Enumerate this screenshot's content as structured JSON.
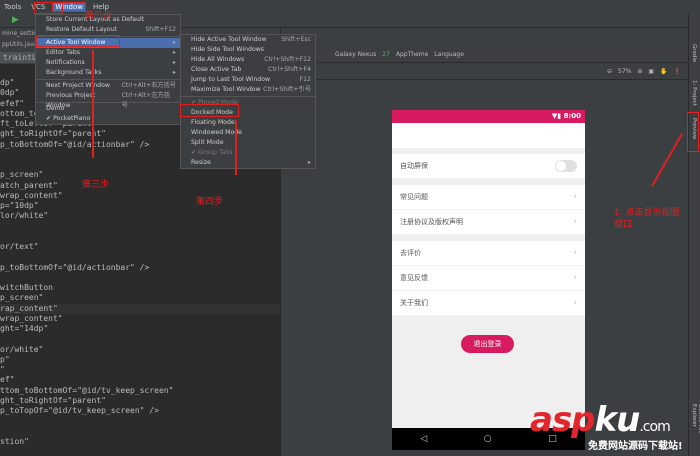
{
  "menubar": [
    "Tools",
    "VCS",
    "Window",
    "Help"
  ],
  "tabs": {
    "file1": "mine_setting",
    "file2": "ppUtils.java",
    "crumb": "traintLa"
  },
  "window_menu": [
    {
      "label": "Store Current Layout as Default",
      "shortcut": ""
    },
    {
      "label": "Restore Default Layout",
      "shortcut": "Shift+F12"
    },
    {
      "label": "Active Tool Window",
      "shortcut": "▸"
    },
    {
      "label": "Editor Tabs",
      "shortcut": "▸"
    },
    {
      "label": "Notifications",
      "shortcut": "▸"
    },
    {
      "label": "Background Tasks",
      "shortcut": "▸"
    },
    {
      "label": "Next Project Window",
      "shortcut": "Ctrl+Alt+右方括号"
    },
    {
      "label": "Previous Project Window",
      "shortcut": "Ctrl+Alt+左方括号"
    },
    {
      "label": "Demo",
      "shortcut": ""
    },
    {
      "label": "✔ PocketPiano",
      "shortcut": ""
    }
  ],
  "submenu": [
    {
      "label": "Hide Active Tool Window",
      "shortcut": "Shift+Esc"
    },
    {
      "label": "Hide Side Tool Windows",
      "shortcut": ""
    },
    {
      "label": "Hide All Windows",
      "shortcut": "Ctrl+Shift+F12"
    },
    {
      "label": "Close Active Tab",
      "shortcut": "Ctrl+Shift+F4"
    },
    {
      "label": "Jump to Last Tool Window",
      "shortcut": "F12"
    },
    {
      "label": "Maximize Tool Window",
      "shortcut": "Ctrl+Shift+引号"
    },
    {
      "label": "✔ Pinned Mode",
      "shortcut": ""
    },
    {
      "label": "Docked Mode",
      "shortcut": ""
    },
    {
      "label": "Floating Mode",
      "shortcut": ""
    },
    {
      "label": "Windowed Mode",
      "shortcut": ""
    },
    {
      "label": "Split Mode",
      "shortcut": ""
    },
    {
      "label": "✔ Group Tabs",
      "shortcut": ""
    },
    {
      "label": "Resize",
      "shortcut": "▸"
    }
  ],
  "code": [
    "dp\"",
    "0dp\"",
    "efef\"",
    "ottom_toB",
    "ft_toLeftOf=\"parent\"",
    "ght_toRightOf=\"parent\"",
    "p_toBottomOf=\"@id/actionbar\" />",
    "",
    "",
    "p_screen\"",
    "atch_parent\"",
    "wrap_content\"",
    "p=\"10dp\"",
    "lor/white\"",
    "",
    "",
    "or/text\"",
    "",
    "p_toBottomOf=\"@id/actionbar\" />",
    "",
    "witchButton",
    "p_screen\"",
    "rap_content\"",
    "wrap_content\"",
    "ght=\"14dp\"",
    "",
    "or/white\"",
    "p\"",
    "\"",
    "ef\"",
    "ttom_toBottomOf=\"@id/tv_keep_screen\"",
    "ght_toRightOf=\"parent\"",
    "p_toTopOf=\"@id/tv_keep_screen\" />",
    "",
    "",
    "stion\""
  ],
  "designer": {
    "device": "Galaxy Nexus",
    "api": "27",
    "theme": "AppTheme",
    "language": "Language",
    "zoom": "57%"
  },
  "side": {
    "gradle": "Gradle",
    "project": "1: Project",
    "preview": "Preview",
    "device_explorer": "Device File Explorer"
  },
  "phone": {
    "time": "8:00",
    "rows": [
      "自动屏保",
      "常见问题",
      "注册协议及版权声明",
      "去评价",
      "意见反馈",
      "关于我们"
    ],
    "logout": "退出登录",
    "toggle_on": false
  },
  "notes": {
    "step1": "1. 点击显示视图窗口",
    "step2": "第二步",
    "step3": "第三步",
    "step4": "第四步"
  },
  "watermark": {
    "brand_red": "asp",
    "brand_white": "ku",
    ".com": ".com",
    "sub": "免费网站源码下载站!"
  },
  "colors": {
    "accent": "#d81b60",
    "annotation": "#e02020"
  }
}
